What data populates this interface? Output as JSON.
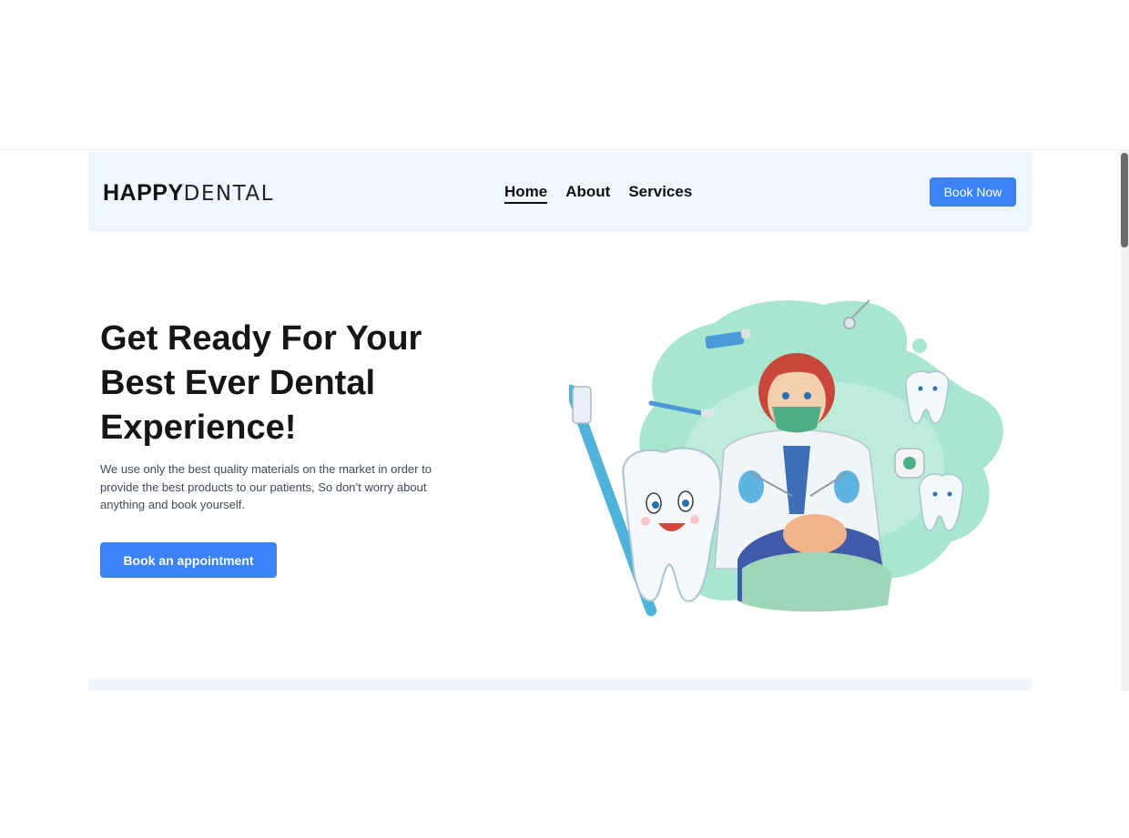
{
  "brand": {
    "strong": "HAPPY",
    "light": "DENTAL"
  },
  "nav": {
    "links": [
      {
        "label": "Home",
        "active": true
      },
      {
        "label": "About",
        "active": false
      },
      {
        "label": "Services",
        "active": false
      }
    ],
    "book_now_label": "Book Now"
  },
  "hero": {
    "title": "Get Ready For Your Best Ever Dental Experience!",
    "description": "We use only the best quality materials on the market in order to provide the best products to our patients, So don’t worry about anything and book yourself.",
    "cta_label": "Book an appointment",
    "illustration_icon": "dentist-illustration"
  },
  "colors": {
    "accent": "#3b82f6",
    "nav_background": "#eff6ff",
    "illustration_mint": "#a8e6cf",
    "text_dark": "#161616"
  }
}
